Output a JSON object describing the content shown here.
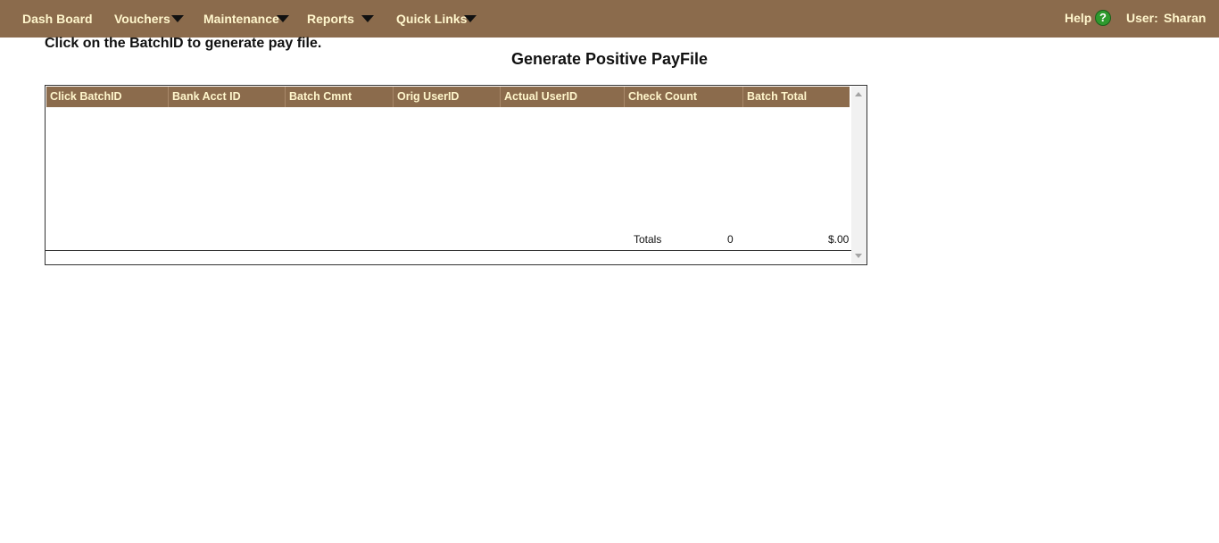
{
  "nav": {
    "dashboard": "Dash Board",
    "vouchers": "Vouchers",
    "maintenance": "Maintenance",
    "reports": "Reports",
    "quick_links": "Quick Links",
    "help": "Help",
    "help_icon_glyph": "?",
    "user_label": "User:",
    "user_name": "Sharan"
  },
  "instruction": "Click on the BatchID to generate pay file.",
  "page_title": "Generate Positive PayFile",
  "table": {
    "columns": [
      "Click BatchID",
      "Bank Acct ID",
      "Batch Cmnt",
      "Orig UserID",
      "Actual UserID",
      "Check Count",
      "Batch Total"
    ],
    "rows": [],
    "totals": {
      "label": "Totals",
      "check_count": "0",
      "batch_total": "$.00"
    }
  },
  "colors": {
    "nav_background": "#8b6b4c",
    "nav_text": "#fff6cc",
    "help_icon": "#2e9a2e"
  },
  "icons": {
    "menu_caret": "chevron-down-icon",
    "help": "help-icon"
  }
}
